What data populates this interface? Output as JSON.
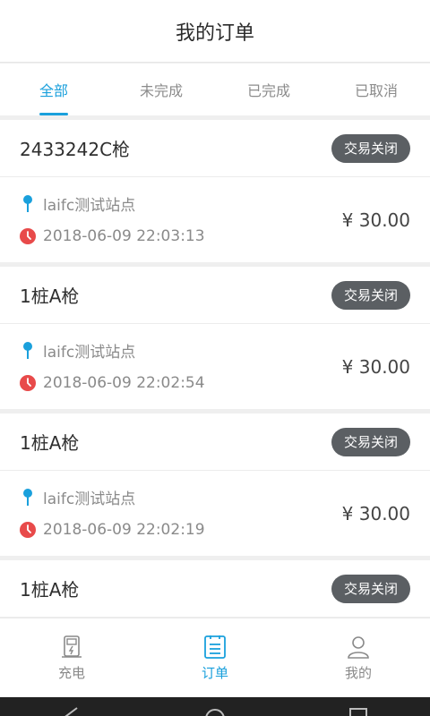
{
  "header": {
    "title": "我的订单"
  },
  "tabs": [
    {
      "label": "全部"
    },
    {
      "label": "未完成"
    },
    {
      "label": "已完成"
    },
    {
      "label": "已取消"
    }
  ],
  "orders": [
    {
      "gun": "2433242C枪",
      "status": "交易关闭",
      "station": "laifc测试站点",
      "time": "2018-06-09 22:03:13",
      "price": "¥ 30.00"
    },
    {
      "gun": "1桩A枪",
      "status": "交易关闭",
      "station": "laifc测试站点",
      "time": "2018-06-09 22:02:54",
      "price": "¥ 30.00"
    },
    {
      "gun": "1桩A枪",
      "status": "交易关闭",
      "station": "laifc测试站点",
      "time": "2018-06-09 22:02:19",
      "price": "¥ 30.00"
    },
    {
      "gun": "1桩A枪",
      "status": "交易关闭"
    }
  ],
  "bottom_nav": [
    {
      "label": "充电",
      "icon": "charger-icon"
    },
    {
      "label": "订单",
      "icon": "order-list-icon"
    },
    {
      "label": "我的",
      "icon": "user-icon"
    }
  ],
  "colors": {
    "accent": "#1aa0dc",
    "badge": "#5b5f63",
    "clock": "#e84a4a"
  }
}
